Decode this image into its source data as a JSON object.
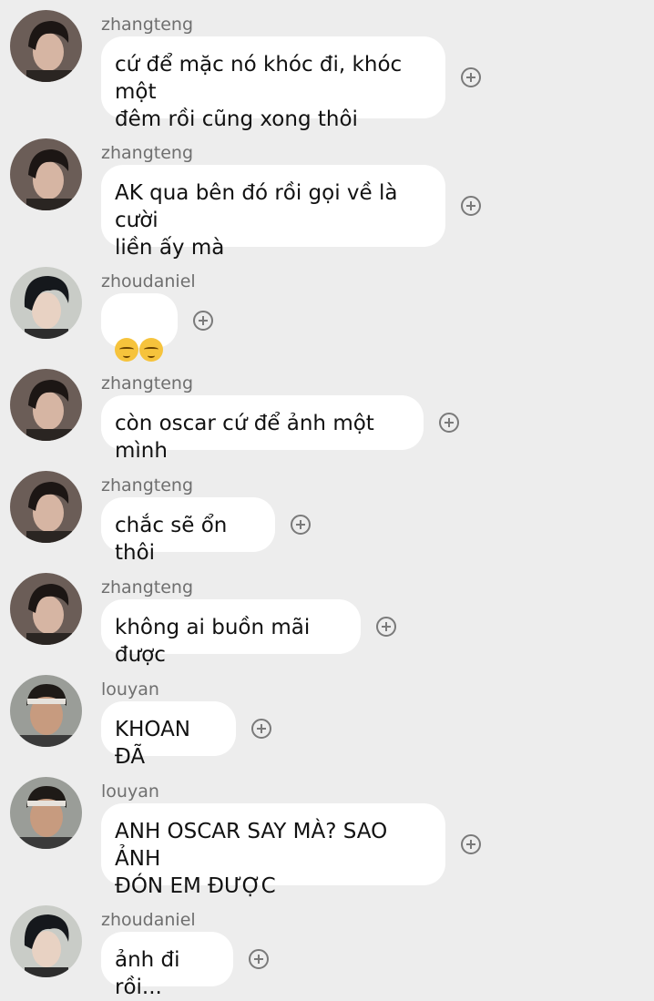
{
  "messages": [
    {
      "sender": "zhangteng",
      "text": "cứ để mặc nó khóc đi, khóc một\nđêm rồi cũng xong thôi"
    },
    {
      "sender": "zhangteng",
      "text": "AK qua bên đó rồi gọi về là cười\nliền ấy mà"
    },
    {
      "sender": "zhoudaniel",
      "emoji": [
        "pensive-face",
        "pensive-face"
      ]
    },
    {
      "sender": "zhangteng",
      "text": "còn oscar cứ để ảnh một mình"
    },
    {
      "sender": "zhangteng",
      "text": "chắc sẽ ổn thôi"
    },
    {
      "sender": "zhangteng",
      "text": "không ai buồn mãi được"
    },
    {
      "sender": "louyan",
      "text": "KHOAN ĐÃ"
    },
    {
      "sender": "louyan",
      "text": "ANH OSCAR SAY MÀ? SAO ẢNH\nĐÓN EM ĐƯỢC"
    },
    {
      "sender": "zhoudaniel",
      "text": "ảnh đi rồi..."
    }
  ],
  "avatars": {
    "zhangteng": {
      "bg": "#6b5d57",
      "hair": "#1c1614",
      "skin": "#d6b5a3"
    },
    "zhoudaniel": {
      "bg": "#c9ccc7",
      "hair": "#15181c",
      "skin": "#e8d2c3"
    },
    "louyan": {
      "bg": "#9a9d98",
      "hair": "#1e1a17",
      "skin": "#c79b7f"
    }
  }
}
